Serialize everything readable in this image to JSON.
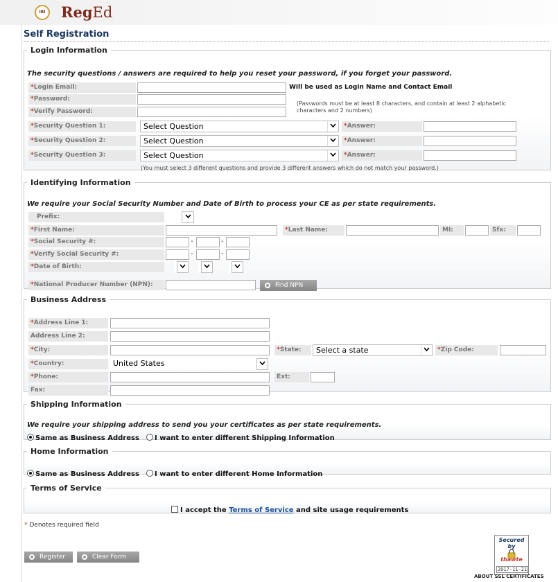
{
  "header": {
    "logo_text": "IRI",
    "brand_bold": "Reg",
    "brand_rest": "Ed"
  },
  "page_title": "Self Registration",
  "login": {
    "legend": "Login Information",
    "intro": "The security questions / answers are required to help you reset your password, if you forget your password.",
    "email_label": "Login Email:",
    "email_note": "Will be used as Login Name and Contact Email",
    "password_label": "Password:",
    "verify_label": "Verify Password:",
    "password_note": "(Passwords must be at least 8 characters, and contain at least 2 alphabetic characters and 2 numbers)",
    "q1_label": "Security Question 1:",
    "q2_label": "Security Question 2:",
    "q3_label": "Security Question 3:",
    "question_placeholder": "Select Question",
    "answer_label": "Answer:",
    "questions_note": "(You must select 3 different questions and provide 3 different answers which do not match your password.)"
  },
  "identifying": {
    "legend": "Identifying Information",
    "intro": "We require your Social Security Number and Date of Birth to process your CE as per state requirements.",
    "prefix_label": "Prefix:",
    "first_label": "First Name:",
    "last_label": "Last Name:",
    "mi_label": "MI:",
    "sfx_label": "Sfx:",
    "ssn_label": "Social Security #:",
    "verify_ssn_label": "Verify Social Security #:",
    "dob_label": "Date of Birth:",
    "npn_label": "National Producer Number (NPN):",
    "find_npn": "Find NPN",
    "dash": "-"
  },
  "business": {
    "legend": "Business Address",
    "addr1_label": "Address Line 1:",
    "addr2_label": "Address Line 2:",
    "city_label": "City:",
    "state_label": "State:",
    "state_value": "Select a state",
    "zip_label": "Zip Code:",
    "country_label": "Country:",
    "country_value": "United States",
    "phone_label": "Phone:",
    "ext_label": "Ext:",
    "fax_label": "Fax:"
  },
  "shipping": {
    "legend": "Shipping Information",
    "intro": "We require your shipping address to send you your certificates as per state requirements.",
    "same": "Same as Business Address",
    "different": "I want to enter different Shipping Information"
  },
  "home": {
    "legend": "Home Information",
    "same": "Same as Business Address",
    "different": "I want to enter different Home Information"
  },
  "terms": {
    "legend": "Terms of Service",
    "prefix": "I accept the",
    "link": "Terms of Service",
    "suffix": "and site usage requirements"
  },
  "required_mark": "*",
  "required_note": "Denotes required field",
  "buttons": {
    "register": "Register",
    "clear": "Clear Form"
  },
  "badge": {
    "line1": "Secured",
    "line2": "by",
    "line3": "thawte",
    "date": "2017-11-21",
    "ssl": "ABOUT SSL CERTIFICATES"
  }
}
